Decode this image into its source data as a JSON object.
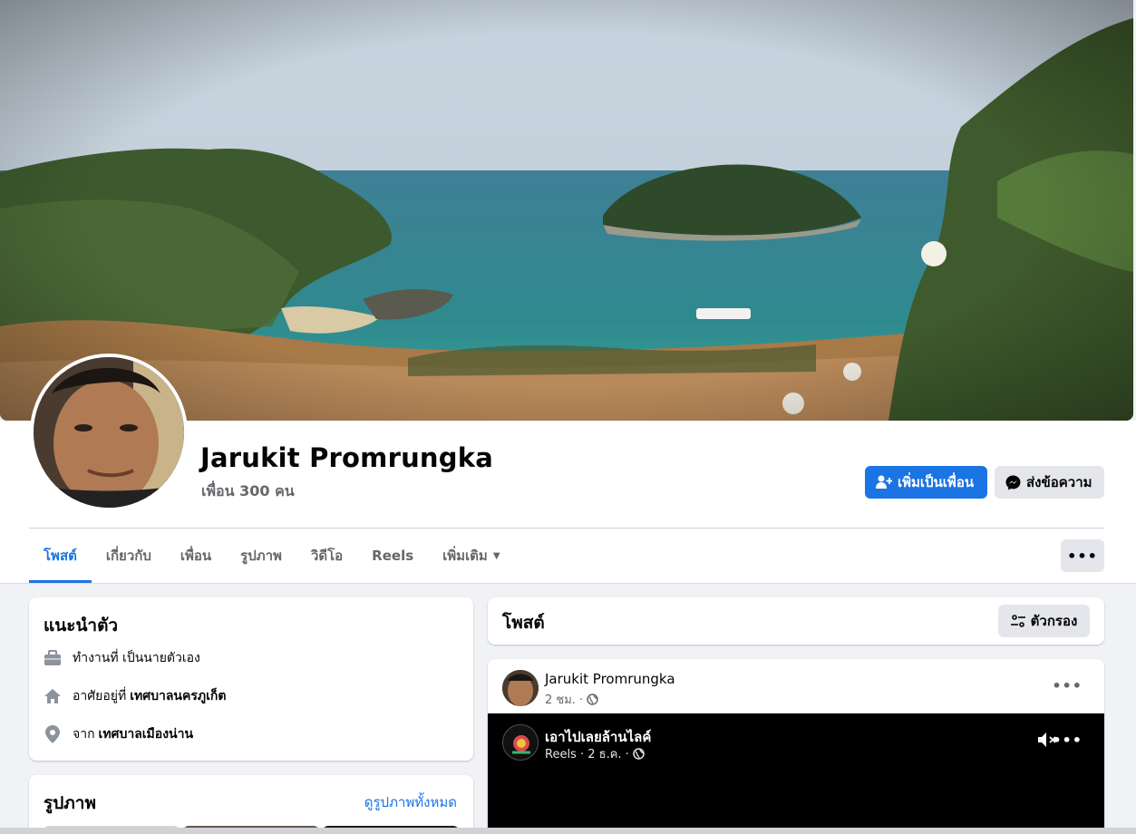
{
  "profile": {
    "name": "Jarukit Promrungka",
    "friends_count": "เพื่อน 300 คน"
  },
  "actions": {
    "add_friend": "เพิ่มเป็นเพื่อน",
    "message": "ส่งข้อความ"
  },
  "tabs": [
    {
      "label": "โพสต์",
      "active": true
    },
    {
      "label": "เกี่ยวกับ"
    },
    {
      "label": "เพื่อน"
    },
    {
      "label": "รูปภาพ"
    },
    {
      "label": "วิดีโอ"
    },
    {
      "label": "Reels"
    },
    {
      "label": "เพิ่มเติม"
    }
  ],
  "more_button": "•••",
  "intro": {
    "title": "แนะนำตัว",
    "work_prefix": "ทำงานที่ เป็นนายตัวเอง",
    "lives_prefix": "อาศัยอยู่ที่",
    "lives_value": "เทศบาลนครภูเก็ต",
    "from_prefix": "จาก",
    "from_value": "เทศบาลเมืองน่าน"
  },
  "photos": {
    "title": "รูปภาพ",
    "see_all": "ดูรูปภาพทั้งหมด"
  },
  "posts": {
    "title": "โพสต์",
    "filter": "ตัวกรอง"
  },
  "post": {
    "author": "Jarukit Promrungka",
    "time": "2 ชม. ·",
    "dots": "•••",
    "reel_title": "เอาไปเลยล้านไลค์",
    "reel_meta": "Reels · 2 ธ.ค. ·"
  },
  "colors": {
    "accent": "#1b74e4",
    "secondary_bg": "#e4e6eb",
    "page_bg": "#f0f2f5"
  },
  "icons": [
    "add-friend-icon",
    "messenger-icon",
    "briefcase-icon",
    "home-icon",
    "location-pin-icon",
    "filter-icon",
    "globe-icon",
    "mute-icon",
    "caret-down-icon"
  ]
}
